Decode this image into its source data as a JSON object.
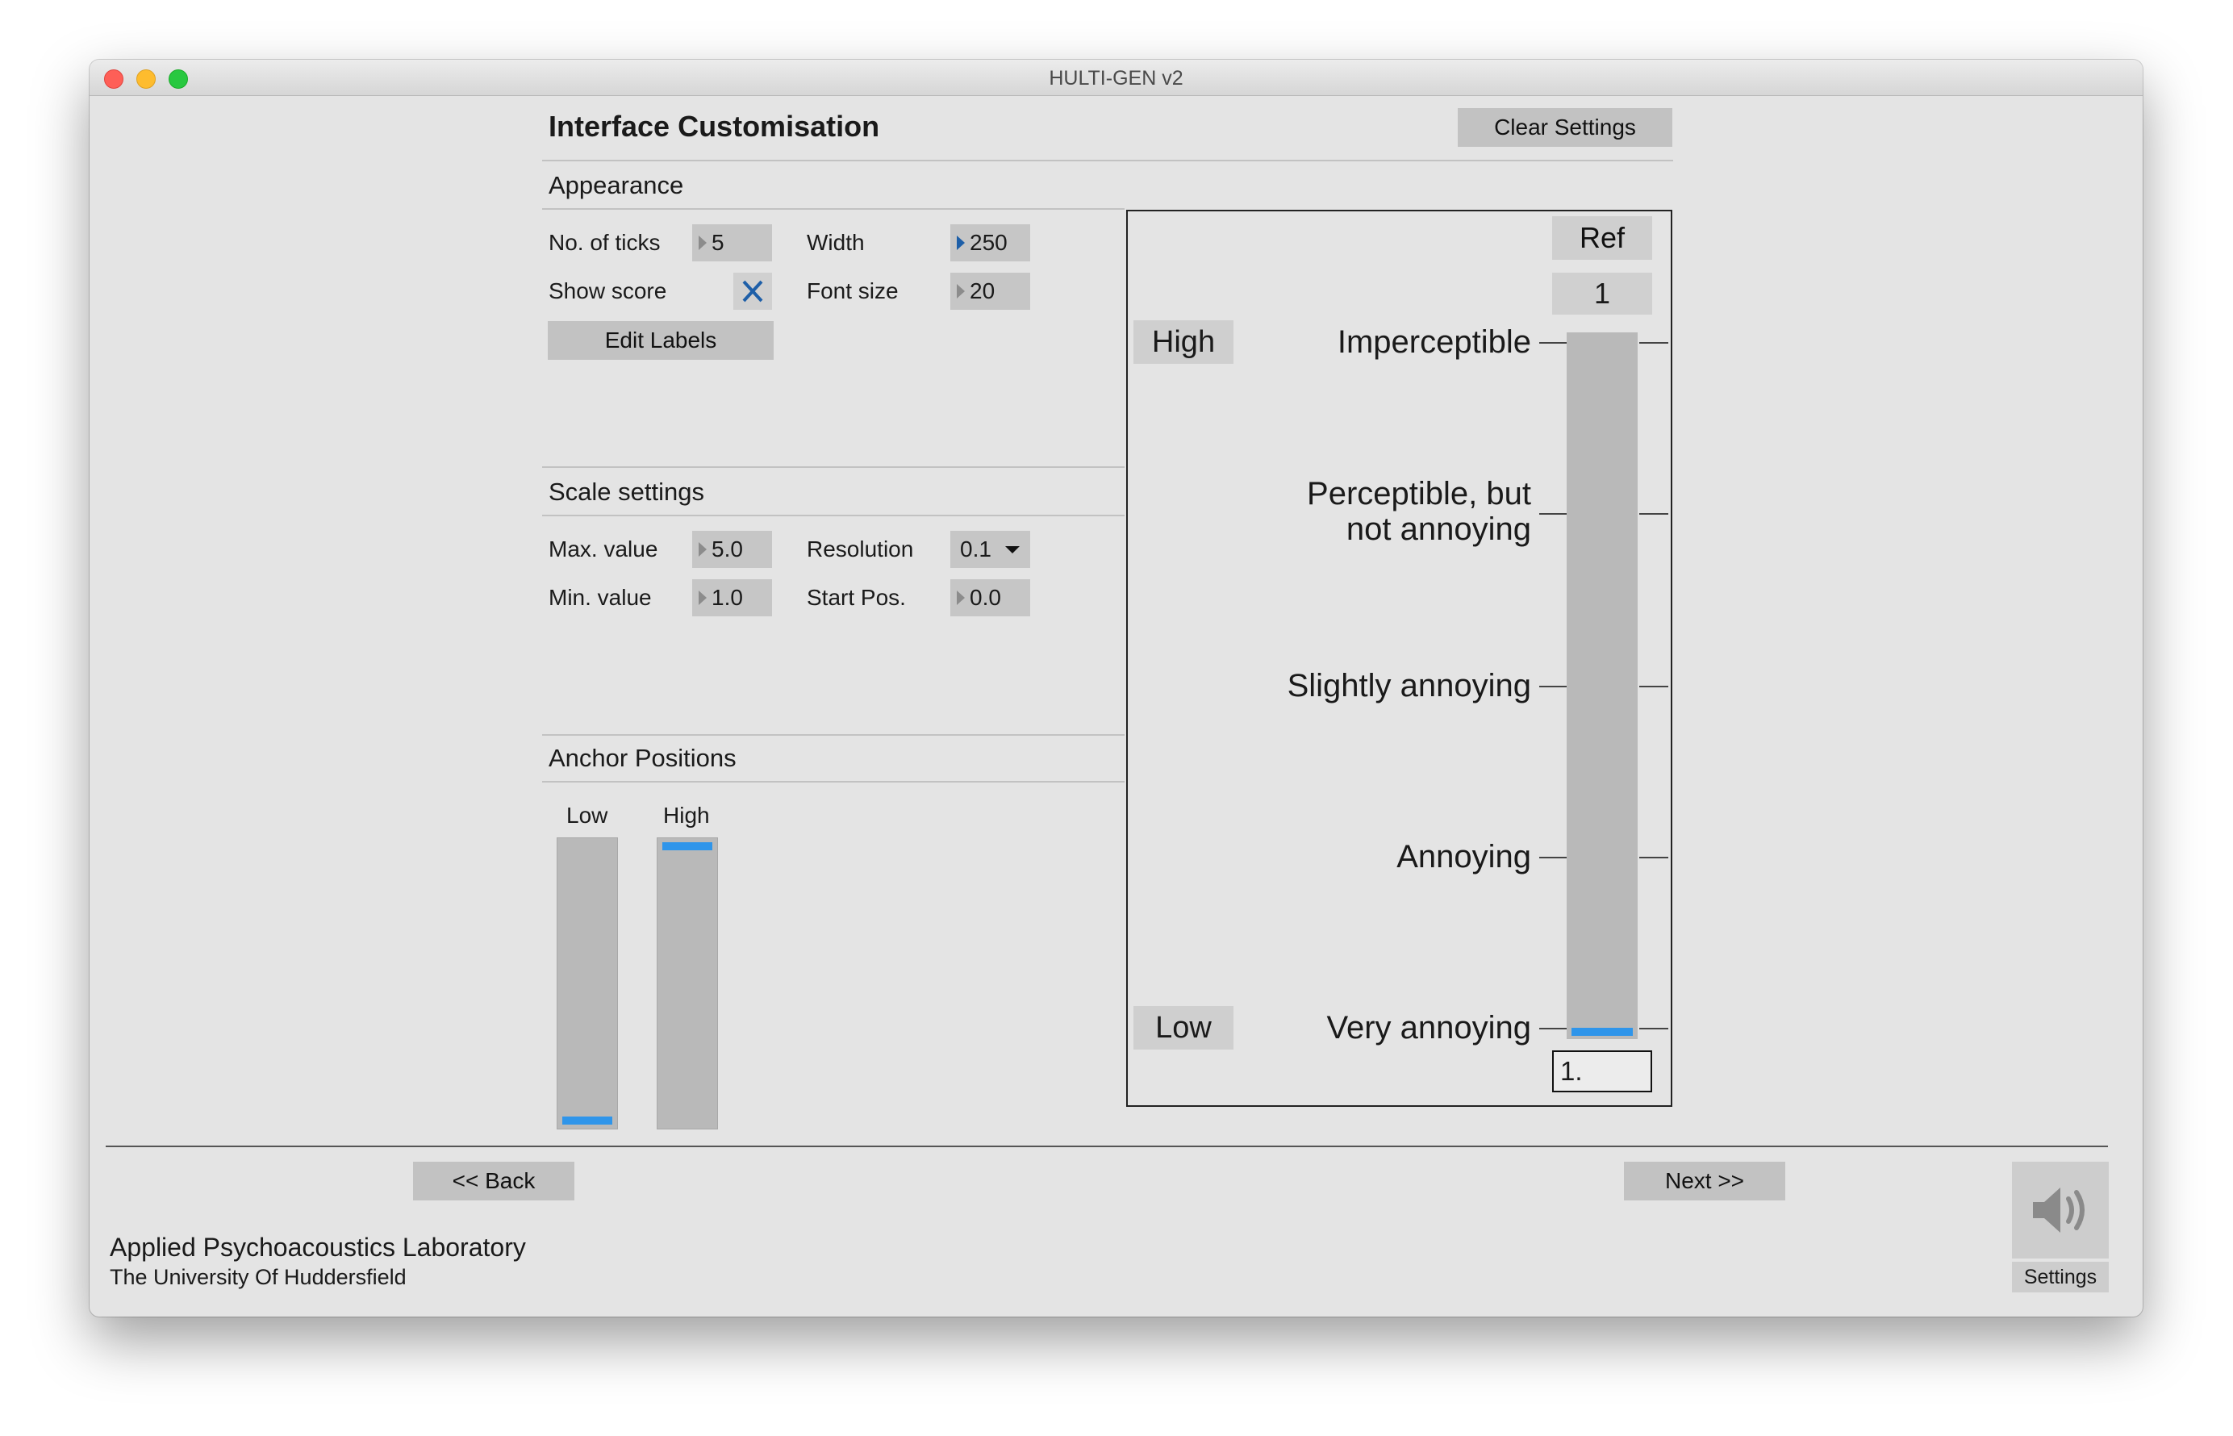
{
  "window": {
    "title": "HULTI-GEN v2"
  },
  "header": {
    "title": "Interface Customisation",
    "clear_button": "Clear Settings"
  },
  "appearance": {
    "section_title": "Appearance",
    "ticks_label": "No. of ticks",
    "ticks_value": "5",
    "width_label": "Width",
    "width_value": "250",
    "show_score_label": "Show score",
    "show_score_checked": true,
    "font_size_label": "Font size",
    "font_size_value": "20",
    "edit_labels_button": "Edit Labels"
  },
  "scale_settings": {
    "section_title": "Scale settings",
    "max_label": "Max. value",
    "max_value": "5.0",
    "resolution_label": "Resolution",
    "resolution_value": "0.1",
    "min_label": "Min. value",
    "min_value": "1.0",
    "start_label": "Start Pos.",
    "start_value": "0.0"
  },
  "anchors": {
    "section_title": "Anchor Positions",
    "low_label": "Low",
    "high_label": "High",
    "low_position": 0.0,
    "high_position": 1.0
  },
  "preview": {
    "ref_button": "Ref",
    "slider_number": "1",
    "high_anchor": "High",
    "low_anchor": "Low",
    "scale_labels": [
      "Imperceptible",
      "Perceptible, but not annoying",
      "Slightly annoying",
      "Annoying",
      "Very annoying"
    ],
    "score_value": "1.",
    "slider_position": 0.0,
    "accent_color": "#2f95ea"
  },
  "footer": {
    "back_button": "<< Back",
    "next_button": "Next >>",
    "lab_name": "Applied Psychoacoustics Laboratory",
    "university": "The University Of Huddersfield",
    "settings_label": "Settings",
    "speaker_icon": "speaker-icon"
  }
}
